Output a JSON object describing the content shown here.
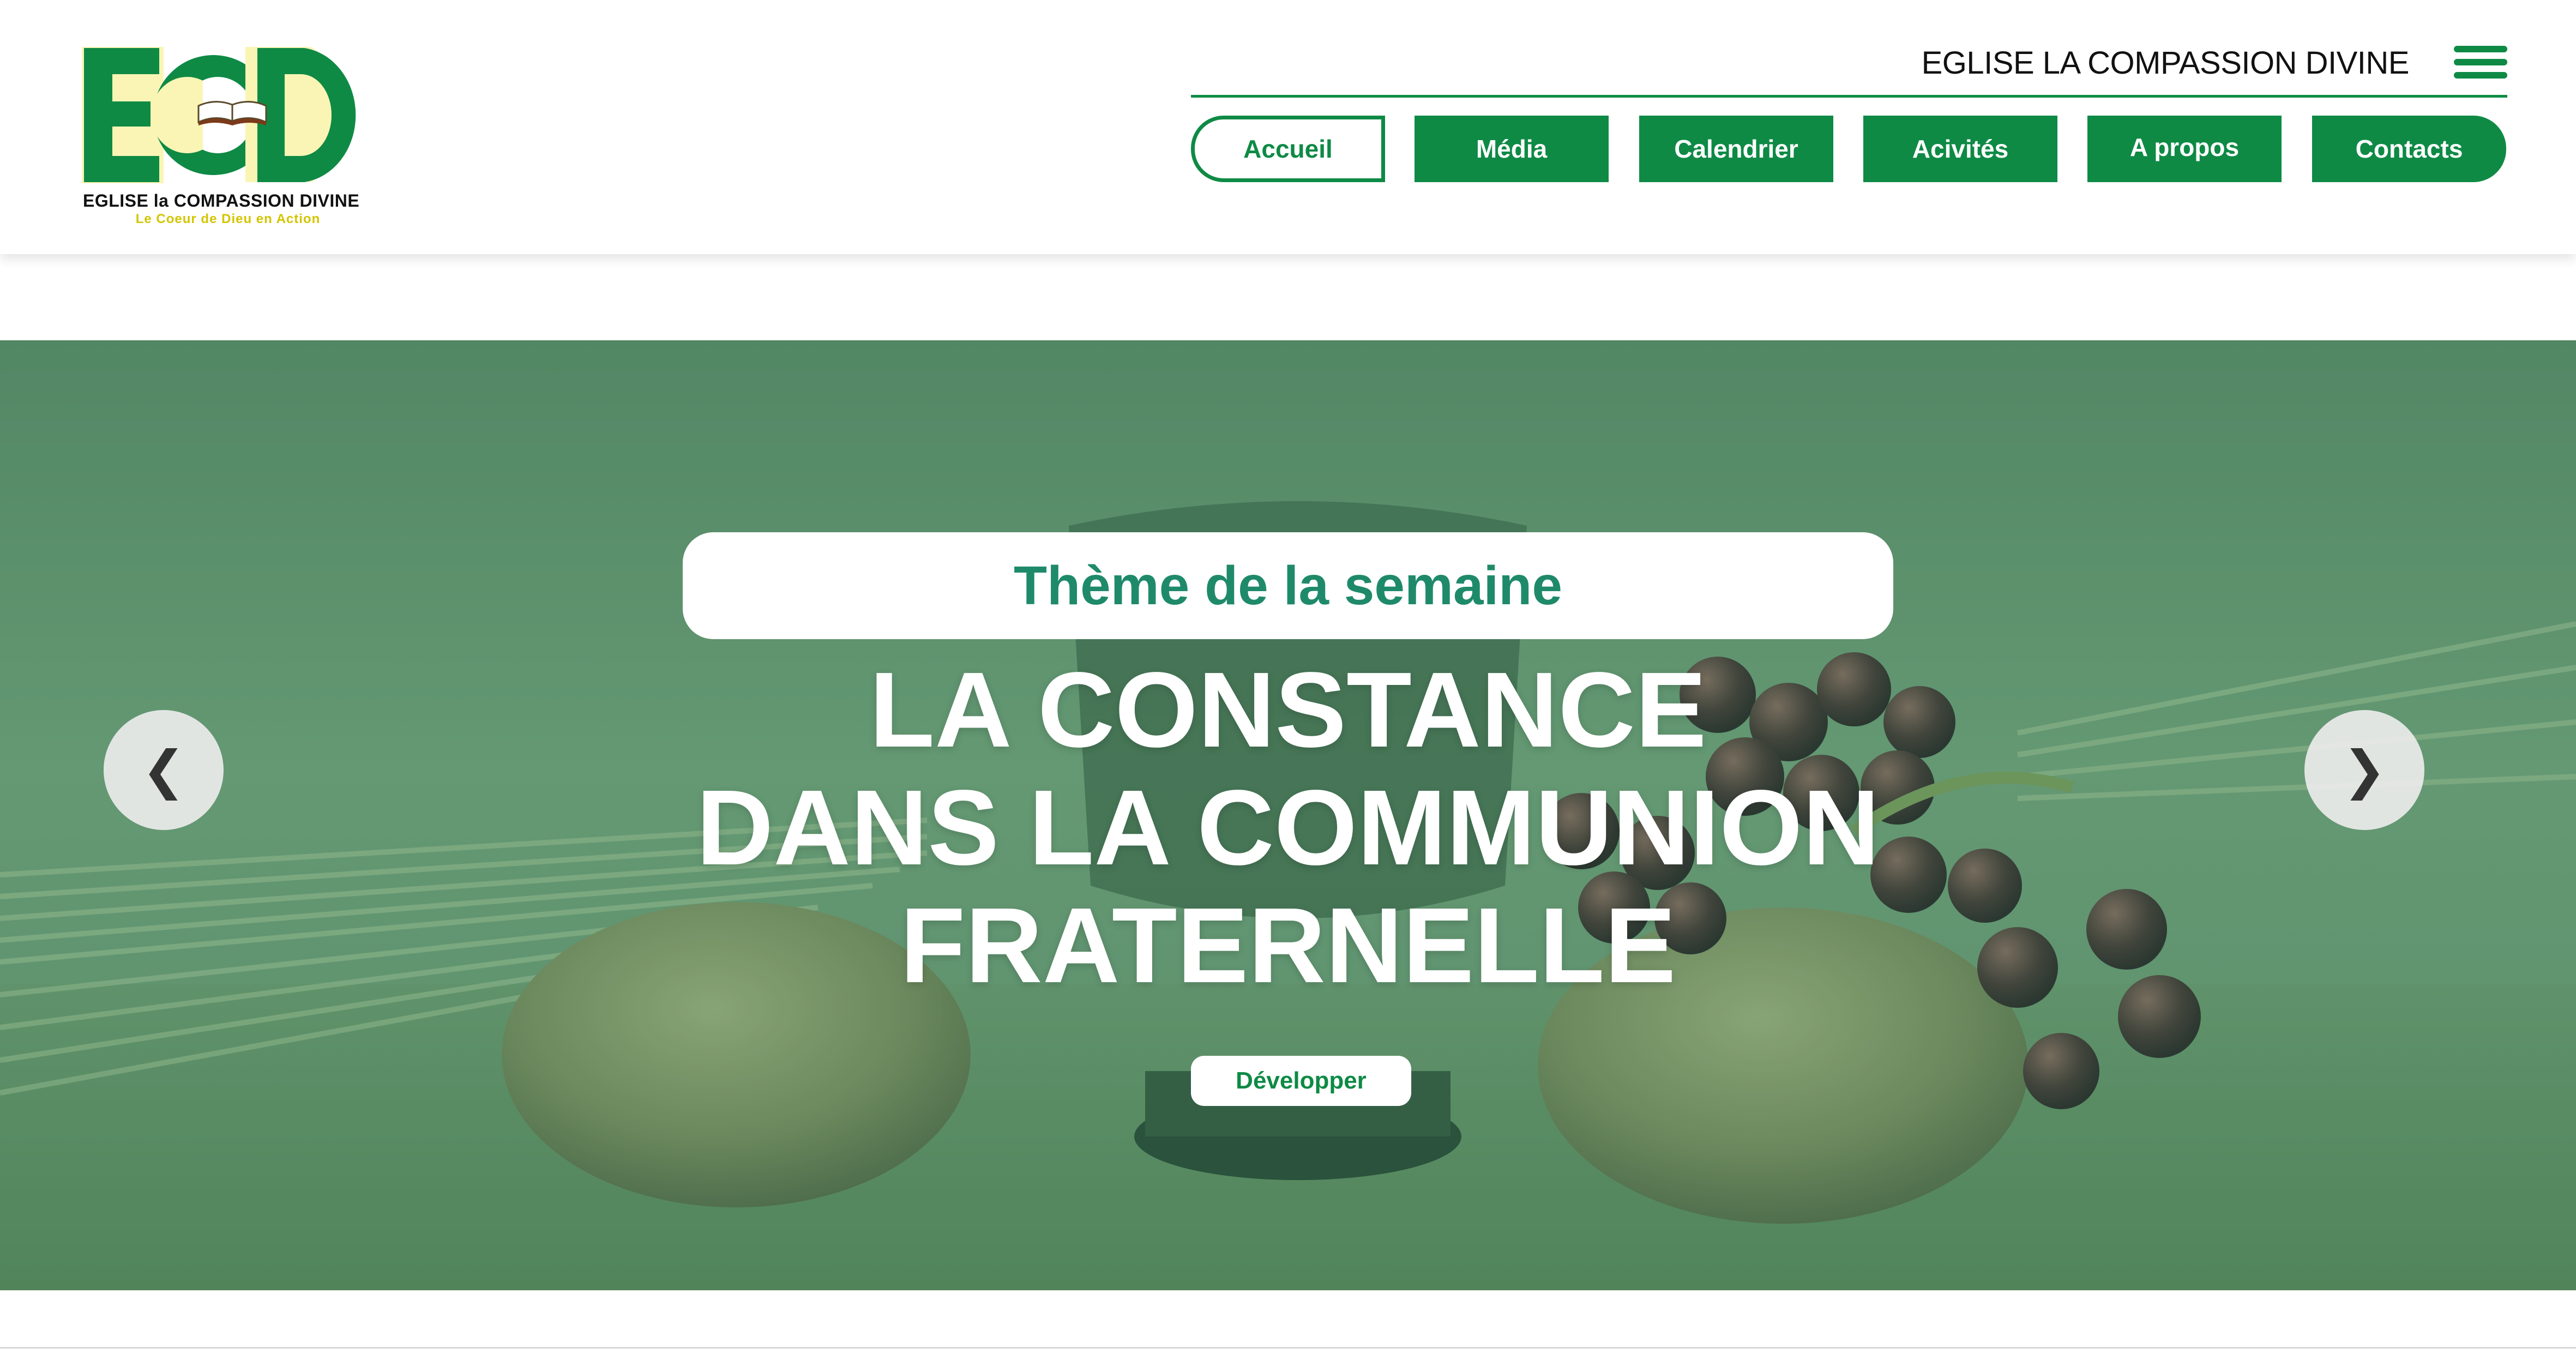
{
  "colors": {
    "brand_green": "#0e8a45",
    "theme_text": "#1f8a6a",
    "logo_cream": "#faf5b4",
    "tagline_yellow": "#d4c400"
  },
  "logo": {
    "letters": "ECD",
    "name": "EGLISE la COMPASSION DIVINE",
    "tagline": "Le Coeur de Dieu en Action",
    "icon": "open-book-icon"
  },
  "header": {
    "church_title": "EGLISE LA COMPASSION DIVINE",
    "menu_icon": "hamburger-menu-icon"
  },
  "nav": {
    "items": [
      {
        "label": "Accueil",
        "active": true
      },
      {
        "label": "Média"
      },
      {
        "label": "Calendrier"
      },
      {
        "label": "Acivités"
      },
      {
        "label": "A propos"
      },
      {
        "label": "Contacts"
      }
    ]
  },
  "hero": {
    "theme_label": "Thème de la semaine",
    "headline_lines": [
      "LA CONSTANCE",
      "DANS LA COMMUNION",
      "FRATERNELLE"
    ],
    "cta_label": "Développer",
    "prev_arrow": "❮",
    "next_arrow": "❯",
    "background_icon": "bread-grapes-chalice-image"
  }
}
